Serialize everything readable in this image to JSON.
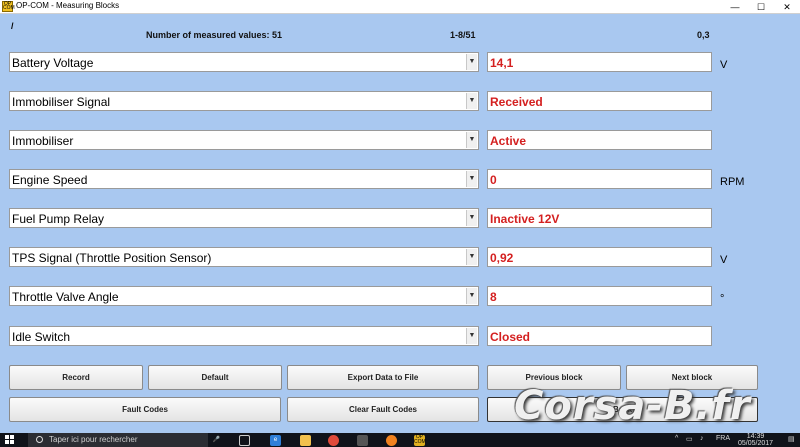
{
  "window": {
    "title": "OP-COM - Measuring Blocks",
    "app_icon_text": "OP COM",
    "minimize": "—",
    "maximize": "☐",
    "close": "✕"
  },
  "header": {
    "slash": "/",
    "measured_values": "Number of measured values: 51",
    "page_range": "1-8/51",
    "time_value": "0,3"
  },
  "rows": [
    {
      "label": "Battery Voltage",
      "value": "14,1",
      "unit": "V"
    },
    {
      "label": "Immobiliser Signal",
      "value": "Received",
      "unit": ""
    },
    {
      "label": "Immobiliser",
      "value": "Active",
      "unit": ""
    },
    {
      "label": "Engine Speed",
      "value": "0",
      "unit": "RPM"
    },
    {
      "label": "Fuel Pump Relay",
      "value": "Inactive 12V",
      "unit": ""
    },
    {
      "label": "TPS Signal (Throttle Position Sensor)",
      "value": "0,92",
      "unit": "V"
    },
    {
      "label": "Throttle Valve Angle",
      "value": "8",
      "unit": "°"
    },
    {
      "label": "Idle Switch",
      "value": "Closed",
      "unit": ""
    }
  ],
  "buttons": {
    "record": "Record",
    "default": "Default",
    "export": "Export Data to File",
    "previous_block": "Previous block",
    "next_block": "Next block",
    "fault_codes": "Fault Codes",
    "clear_fault_codes": "Clear Fault Codes",
    "back": "Back"
  },
  "watermark": "Corsa-B.fr",
  "taskbar": {
    "search_placeholder": "Taper ici pour rechercher",
    "opcom_icon_text": "OP COM",
    "language": "FRA",
    "time": "14:39",
    "date": "05/05/2017",
    "colors": {
      "edge": "#2f7fd8",
      "folder": "#f2c14e",
      "chrome": "#e04a3a",
      "firefox": "#f0821f",
      "opcom": "#e0b020"
    }
  },
  "colors": {
    "background": "#a9c8f0",
    "value_text": "#d42020"
  }
}
